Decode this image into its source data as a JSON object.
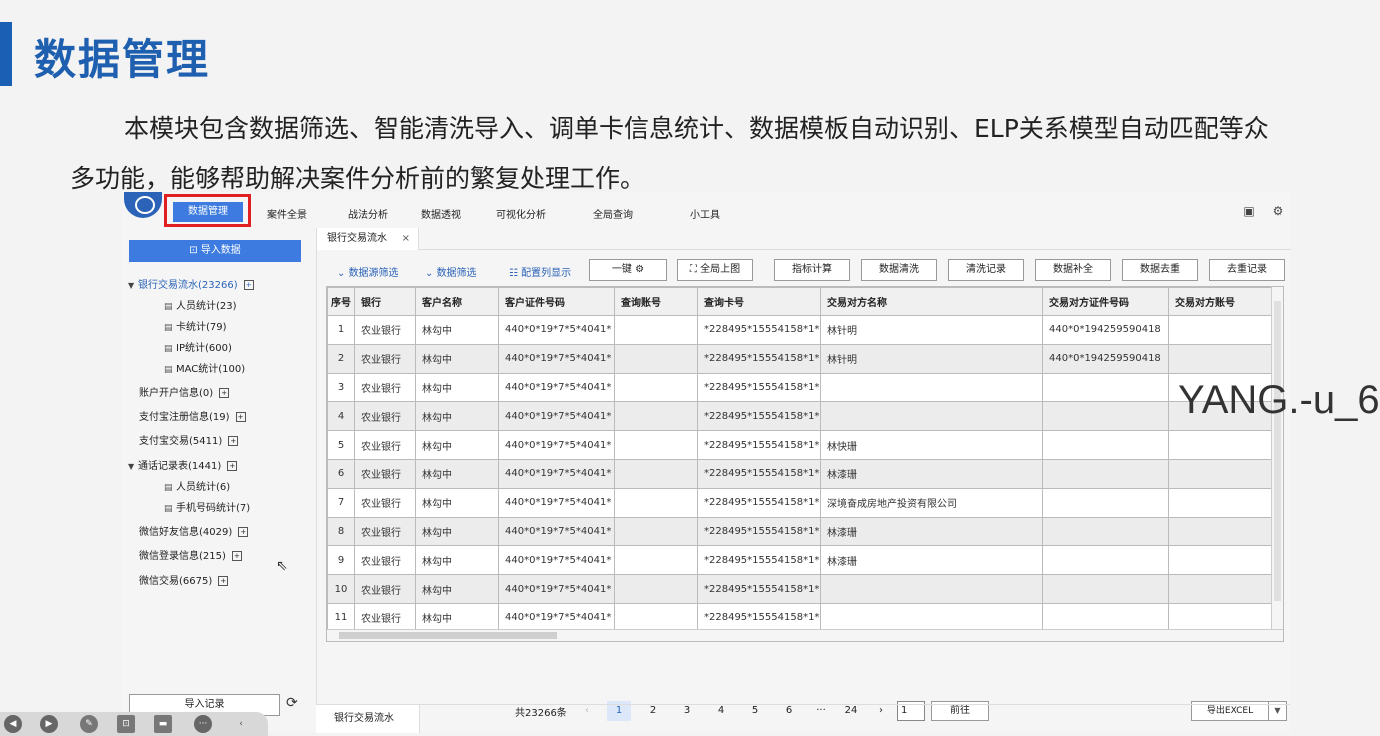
{
  "slide": {
    "title": "数据管理",
    "description": "本模块包含数据筛选、智能清洗导入、调单卡信息统计、数据模板自动识别、ELP关系模型自动匹配等众多功能，能够帮助解决案件分析前的繁复处理工作。",
    "watermark": "YANG.-u_6",
    "accent_color": "#1a5fb4"
  },
  "nav": {
    "items": [
      "数据管理",
      "案件全景",
      "战法分析",
      "数据透视",
      "可视化分析",
      "全局查询",
      "小工具"
    ],
    "icons": [
      "save-icon",
      "gear-icon"
    ]
  },
  "sidebar": {
    "import_button": "⊡ 导入数据",
    "tree": {
      "bank": "银行交易流水(23266)",
      "bank_children": [
        "人员统计(23)",
        "卡统计(79)",
        "IP统计(600)",
        "MAC统计(100)"
      ],
      "account": "账户开户信息(0)",
      "alipay_reg": "支付宝注册信息(19)",
      "alipay_tx": "支付宝交易(5411)",
      "calls": "通话记录表(1441)",
      "calls_children": [
        "人员统计(6)",
        "手机号码统计(7)"
      ],
      "wechat_friends": "微信好友信息(4029)",
      "wechat_login": "微信登录信息(215)",
      "wechat_tx": "微信交易(6675)"
    },
    "records_button": "导入记录"
  },
  "main": {
    "tab_label": "银行交易流水",
    "tab_close": "×",
    "toolbar": {
      "source_filter": "数据源筛选",
      "data_filter": "数据筛选",
      "column_config": "配置列显示",
      "one_click": "一键",
      "global_chart": "全局上图",
      "buttons": [
        "指标计算",
        "数据清洗",
        "清洗记录",
        "数据补全",
        "数据去重",
        "去重记录"
      ]
    },
    "table": {
      "headers": [
        "序号",
        "银行",
        "客户名称",
        "客户证件号码",
        "查询账号",
        "查询卡号",
        "交易对方名称",
        "交易对方证件号码",
        "交易对方账号"
      ],
      "rows": [
        [
          "1",
          "农业银行",
          "林勾中",
          "440*0*19*7*5*4041*",
          "",
          "*228495*15554158*1*",
          "林针明",
          "440*0*194259590418",
          ""
        ],
        [
          "2",
          "农业银行",
          "林勾中",
          "440*0*19*7*5*4041*",
          "",
          "*228495*15554158*1*",
          "林针明",
          "440*0*194259590418",
          ""
        ],
        [
          "3",
          "农业银行",
          "林勾中",
          "440*0*19*7*5*4041*",
          "",
          "*228495*15554158*1*",
          "",
          "",
          ""
        ],
        [
          "4",
          "农业银行",
          "林勾中",
          "440*0*19*7*5*4041*",
          "",
          "*228495*15554158*1*",
          "",
          "",
          ""
        ],
        [
          "5",
          "农业银行",
          "林勾中",
          "440*0*19*7*5*4041*",
          "",
          "*228495*15554158*1*",
          "林快珊",
          "",
          ""
        ],
        [
          "6",
          "农业银行",
          "林勾中",
          "440*0*19*7*5*4041*",
          "",
          "*228495*15554158*1*",
          "林漆珊",
          "",
          ""
        ],
        [
          "7",
          "农业银行",
          "林勾中",
          "440*0*19*7*5*4041*",
          "",
          "*228495*15554158*1*",
          "深境奋成房地产投资有限公司",
          "",
          ""
        ],
        [
          "8",
          "农业银行",
          "林勾中",
          "440*0*19*7*5*4041*",
          "",
          "*228495*15554158*1*",
          "林漆珊",
          "",
          ""
        ],
        [
          "9",
          "农业银行",
          "林勾中",
          "440*0*19*7*5*4041*",
          "",
          "*228495*15554158*1*",
          "林漆珊",
          "",
          ""
        ],
        [
          "10",
          "农业银行",
          "林勾中",
          "440*0*19*7*5*4041*",
          "",
          "*228495*15554158*1*",
          "",
          "",
          ""
        ],
        [
          "11",
          "农业银行",
          "林勾中",
          "440*0*19*7*5*4041*",
          "",
          "*228495*15554158*1*",
          "",
          "",
          ""
        ]
      ]
    },
    "pagination": {
      "total": "共23266条",
      "pages": [
        "1",
        "2",
        "3",
        "4",
        "5",
        "6",
        "···",
        "24"
      ],
      "active_page": "1",
      "prev": "‹",
      "next": "›",
      "jump_value": "1",
      "go": "前往"
    },
    "export": "导出EXCEL",
    "bottom_tab": "银行交易流水"
  }
}
